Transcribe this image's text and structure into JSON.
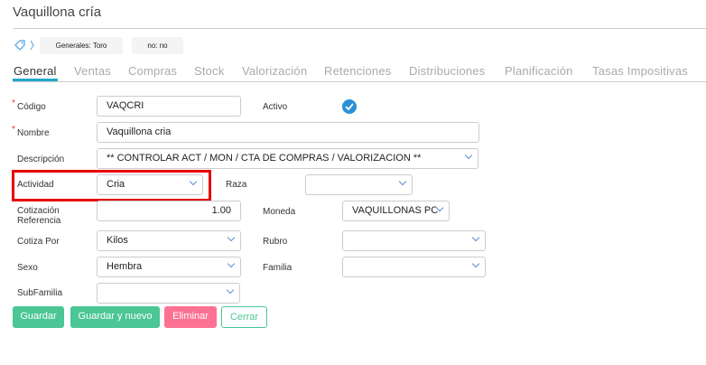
{
  "title": "Vaquillona cría",
  "chips": [
    "Generales: Toro",
    "no: no"
  ],
  "tabs": [
    "General",
    "Ventas",
    "Compras",
    "Stock",
    "Valorización",
    "Retenciones",
    "Distribuciones",
    "Planificación",
    "Tasas Impositivas"
  ],
  "fields": {
    "codigo": {
      "label": "Código",
      "value": "VAQCRI"
    },
    "activo": {
      "label": "Activo",
      "checked": true
    },
    "nombre": {
      "label": "Nombre",
      "value": "Vaquillona cria"
    },
    "descripcion": {
      "label": "Descripción",
      "value": "** CONTROLAR ACT / MON /  CTA DE COMPRAS  / VALORIZACION **"
    },
    "actividad": {
      "label": "Actividad",
      "value": "Cria"
    },
    "raza": {
      "label": "Raza",
      "value": ""
    },
    "cotizacion": {
      "label1": "Cotización",
      "label2": "Referencia",
      "value": "1.00"
    },
    "moneda": {
      "label": "Moneda",
      "value": "VAQUILLONAS PC"
    },
    "cotiza_por": {
      "label": "Cotiza Por",
      "value": "Kilos"
    },
    "rubro": {
      "label": "Rubro",
      "value": ""
    },
    "sexo": {
      "label": "Sexo",
      "value": "Hembra"
    },
    "familia": {
      "label": "Familia",
      "value": ""
    },
    "subfamilia": {
      "label": "SubFamilia",
      "value": ""
    }
  },
  "buttons": {
    "guardar": "Guardar",
    "guardar_nuevo": "Guardar y nuevo",
    "eliminar": "Eliminar",
    "cerrar": "Cerrar"
  },
  "colors": {
    "accent": "#1fa9c9",
    "green": "#4bc694",
    "red": "#fd7192",
    "highlight": "#e60000"
  }
}
